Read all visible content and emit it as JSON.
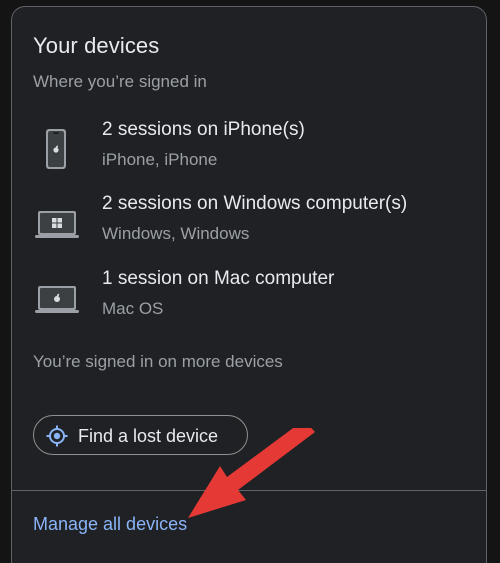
{
  "card": {
    "title": "Your devices",
    "subtitle": "Where you’re signed in"
  },
  "devices": [
    {
      "name": "2 sessions on iPhone(s)",
      "detail": "iPhone, iPhone",
      "icon": "iphone-icon"
    },
    {
      "name": "2 sessions on Windows computer(s)",
      "detail": "Windows, Windows",
      "icon": "windows-laptop-icon"
    },
    {
      "name": "1 session on Mac computer",
      "detail": "Mac OS",
      "icon": "mac-laptop-icon"
    }
  ],
  "more_devices_text": "You’re signed in on more devices",
  "find_button": {
    "label": "Find a lost device",
    "icon": "locate-icon"
  },
  "manage_link": {
    "label": "Manage all devices"
  },
  "annotation": {
    "icon": "red-arrow-icon",
    "color": "#e53935"
  },
  "colors": {
    "background": "#202124",
    "text_primary": "#e8eaed",
    "text_secondary": "#9aa0a6",
    "link": "#8ab4f8",
    "border": "#5f6368"
  }
}
